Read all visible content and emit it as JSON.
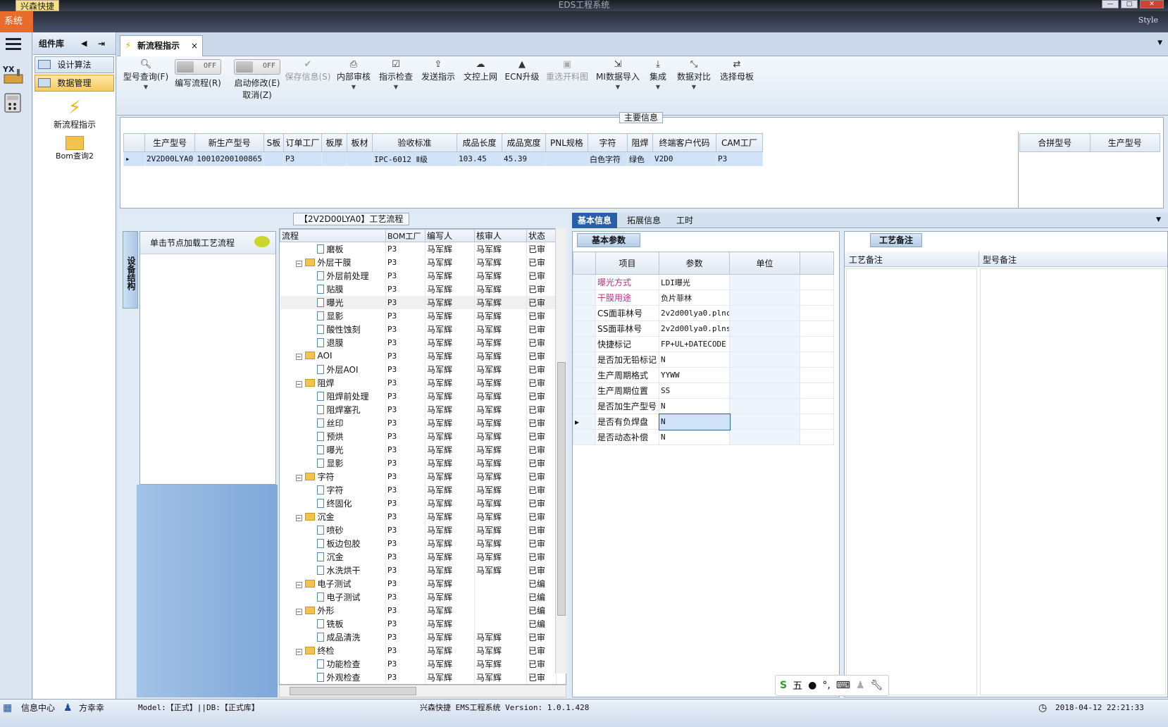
{
  "window": {
    "title": "EDS工程系统",
    "brand": "兴森快捷",
    "style_label": "Style"
  },
  "system_menu": "系统",
  "component_lib": {
    "title": "组件库",
    "nav": [
      {
        "label": "设计算法"
      },
      {
        "label": "数据管理"
      }
    ],
    "tools": [
      {
        "label": "新流程指示"
      },
      {
        "label": "Bom查询2"
      }
    ]
  },
  "tab": {
    "label": "新流程指示"
  },
  "toolbar": {
    "items": [
      {
        "label": "型号查询(F)"
      },
      {
        "label": "编写流程(R)",
        "toggle": "OFF"
      },
      {
        "label": "启动修改(E)",
        "sub": "取消(Z)",
        "toggle": "OFF"
      },
      {
        "label": "保存信息(S)"
      },
      {
        "label": "内部审核"
      },
      {
        "label": "指示检查"
      },
      {
        "label": "发送指示"
      },
      {
        "label": "文控上网"
      },
      {
        "label": "ECN升级"
      },
      {
        "label": "重选开料图"
      },
      {
        "label": "MI数据导入"
      },
      {
        "label": "集成"
      },
      {
        "label": "数据对比"
      },
      {
        "label": "选择母板"
      }
    ]
  },
  "main_info": {
    "title": "主要信息",
    "columns": [
      "生产型号",
      "新生产型号",
      "S板",
      "订单工厂",
      "板厚",
      "板材",
      "验收标准",
      "成品长度",
      "成品宽度",
      "PNL规格",
      "字符",
      "阻焊",
      "终端客户代码",
      "CAM工厂"
    ],
    "row": [
      "2V2D00LYA0",
      "10010200100865",
      "",
      "P3",
      "",
      "",
      "IPC-6012 Ⅱ级",
      "103.45",
      "45.39",
      "",
      "白色字符",
      "绿色",
      "V2D0",
      "P3"
    ],
    "merge_columns": [
      "合拼型号",
      "生产型号"
    ]
  },
  "flow": {
    "title": "【2V2D00LYA0】工艺流程",
    "side_tab": "设备结构",
    "click_hint": "单击节点加载工艺流程",
    "columns": [
      "流程",
      "BOM工厂",
      "编写人",
      "核审人",
      "状态"
    ],
    "rows": [
      {
        "name": "磨板",
        "lvl": 2,
        "bom": "P3",
        "writer": "马军辉",
        "reviewer": "马军辉",
        "status": "已审"
      },
      {
        "name": "外层干膜",
        "lvl": 1,
        "bom": "P3",
        "writer": "马军辉",
        "reviewer": "马军辉",
        "status": "已审"
      },
      {
        "name": "外层前处理",
        "lvl": 2,
        "bom": "P3",
        "writer": "马军辉",
        "reviewer": "马军辉",
        "status": "已审"
      },
      {
        "name": "贴膜",
        "lvl": 2,
        "bom": "P3",
        "writer": "马军辉",
        "reviewer": "马军辉",
        "status": "已审"
      },
      {
        "name": "曝光",
        "lvl": 2,
        "bom": "P3",
        "writer": "马军辉",
        "reviewer": "马军辉",
        "status": "已审"
      },
      {
        "name": "显影",
        "lvl": 2,
        "bom": "P3",
        "writer": "马军辉",
        "reviewer": "马军辉",
        "status": "已审"
      },
      {
        "name": "酸性蚀刻",
        "lvl": 2,
        "bom": "P3",
        "writer": "马军辉",
        "reviewer": "马军辉",
        "status": "已审"
      },
      {
        "name": "退膜",
        "lvl": 2,
        "bom": "P3",
        "writer": "马军辉",
        "reviewer": "马军辉",
        "status": "已审"
      },
      {
        "name": "AOI",
        "lvl": 1,
        "bom": "P3",
        "writer": "马军辉",
        "reviewer": "马军辉",
        "status": "已审"
      },
      {
        "name": "外层AOI",
        "lvl": 2,
        "bom": "P3",
        "writer": "马军辉",
        "reviewer": "马军辉",
        "status": "已审"
      },
      {
        "name": "阻焊",
        "lvl": 1,
        "bom": "P3",
        "writer": "马军辉",
        "reviewer": "马军辉",
        "status": "已审"
      },
      {
        "name": "阻焊前处理",
        "lvl": 2,
        "bom": "P3",
        "writer": "马军辉",
        "reviewer": "马军辉",
        "status": "已审"
      },
      {
        "name": "阻焊塞孔",
        "lvl": 2,
        "bom": "P3",
        "writer": "马军辉",
        "reviewer": "马军辉",
        "status": "已审"
      },
      {
        "name": "丝印",
        "lvl": 2,
        "bom": "P3",
        "writer": "马军辉",
        "reviewer": "马军辉",
        "status": "已审"
      },
      {
        "name": "预烘",
        "lvl": 2,
        "bom": "P3",
        "writer": "马军辉",
        "reviewer": "马军辉",
        "status": "已审"
      },
      {
        "name": "曝光",
        "lvl": 2,
        "bom": "P3",
        "writer": "马军辉",
        "reviewer": "马军辉",
        "status": "已审"
      },
      {
        "name": "显影",
        "lvl": 2,
        "bom": "P3",
        "writer": "马军辉",
        "reviewer": "马军辉",
        "status": "已审"
      },
      {
        "name": "字符",
        "lvl": 1,
        "bom": "P3",
        "writer": "马军辉",
        "reviewer": "马军辉",
        "status": "已审"
      },
      {
        "name": "字符",
        "lvl": 2,
        "bom": "P3",
        "writer": "马军辉",
        "reviewer": "马军辉",
        "status": "已审"
      },
      {
        "name": "终固化",
        "lvl": 2,
        "bom": "P3",
        "writer": "马军辉",
        "reviewer": "马军辉",
        "status": "已审"
      },
      {
        "name": "沉金",
        "lvl": 1,
        "bom": "P3",
        "writer": "马军辉",
        "reviewer": "马军辉",
        "status": "已审"
      },
      {
        "name": "喷砂",
        "lvl": 2,
        "bom": "P3",
        "writer": "马军辉",
        "reviewer": "马军辉",
        "status": "已审"
      },
      {
        "name": "板边包胶",
        "lvl": 2,
        "bom": "P3",
        "writer": "马军辉",
        "reviewer": "马军辉",
        "status": "已审"
      },
      {
        "name": "沉金",
        "lvl": 2,
        "bom": "P3",
        "writer": "马军辉",
        "reviewer": "马军辉",
        "status": "已审"
      },
      {
        "name": "水洗烘干",
        "lvl": 2,
        "bom": "P3",
        "writer": "马军辉",
        "reviewer": "马军辉",
        "status": "已审"
      },
      {
        "name": "电子测试",
        "lvl": 1,
        "bom": "P3",
        "writer": "马军辉",
        "reviewer": "",
        "status": "已编"
      },
      {
        "name": "电子测试",
        "lvl": 2,
        "bom": "P3",
        "writer": "马军辉",
        "reviewer": "",
        "status": "已编"
      },
      {
        "name": "外形",
        "lvl": 1,
        "bom": "P3",
        "writer": "马军辉",
        "reviewer": "",
        "status": "已编"
      },
      {
        "name": "铣板",
        "lvl": 2,
        "bom": "P3",
        "writer": "马军辉",
        "reviewer": "",
        "status": "已编"
      },
      {
        "name": "成品清洗",
        "lvl": 2,
        "bom": "P3",
        "writer": "马军辉",
        "reviewer": "马军辉",
        "status": "已审"
      },
      {
        "name": "终检",
        "lvl": 1,
        "bom": "P3",
        "writer": "马军辉",
        "reviewer": "马军辉",
        "status": "已审"
      },
      {
        "name": "功能检查",
        "lvl": 2,
        "bom": "P3",
        "writer": "马军辉",
        "reviewer": "马军辉",
        "status": "已审"
      },
      {
        "name": "外观检查",
        "lvl": 2,
        "bom": "P3",
        "writer": "马军辉",
        "reviewer": "马军辉",
        "status": "已审"
      }
    ]
  },
  "right_tabs": [
    "基本信息",
    "拓展信息",
    "工时"
  ],
  "basic_params": {
    "caption": "基本参数",
    "columns": [
      "项目",
      "参数",
      "单位"
    ],
    "rows": [
      {
        "item": "曝光方式",
        "value": "LDI曝光",
        "unit": "",
        "highlight": true
      },
      {
        "item": "干膜用途",
        "value": "负片菲林",
        "unit": "",
        "highlight": true
      },
      {
        "item": "CS面菲林号",
        "value": "2v2d00lya0.plncs",
        "unit": ""
      },
      {
        "item": "SS面菲林号",
        "value": "2v2d00lya0.plnss",
        "unit": ""
      },
      {
        "item": "快捷标记",
        "value": "FP+UL+DATECODE",
        "unit": ""
      },
      {
        "item": "是否加无铅标记",
        "value": "N",
        "unit": ""
      },
      {
        "item": "生产周期格式",
        "value": "YYWW",
        "unit": ""
      },
      {
        "item": "生产周期位置",
        "value": "SS",
        "unit": ""
      },
      {
        "item": "是否加生产型号",
        "value": "N",
        "unit": ""
      },
      {
        "item": "是否有负焊盘",
        "value": "N",
        "unit": "",
        "selected": true
      },
      {
        "item": "是否动态补偿",
        "value": "N",
        "unit": ""
      }
    ]
  },
  "craft_notes": {
    "caption": "工艺备注",
    "col1": "工艺备注",
    "col2": "型号备注"
  },
  "status": {
    "info_center": "信息中心",
    "user": "方幸幸",
    "model": "Model:【正式】||DB:【正式库】",
    "version": "兴森快捷 EMS工程系统 Version: 1.0.1.428",
    "datetime": "2018-04-12 22:21:33"
  },
  "ime": {
    "label": "五"
  },
  "colors": {
    "accent": "#2a5ea9",
    "highlight_text": "#c0308a",
    "active_nav": "#f8c960",
    "system_menu": "#e86b2a"
  }
}
